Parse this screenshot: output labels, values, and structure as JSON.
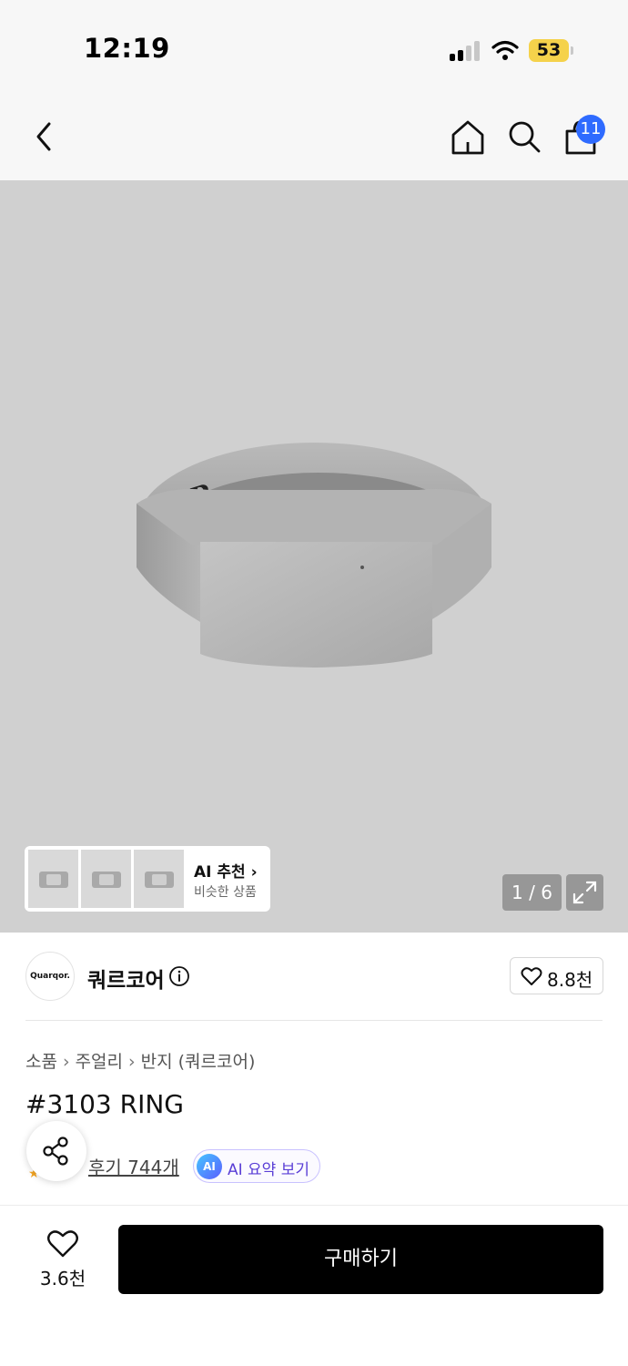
{
  "status_bar": {
    "time": "12:19",
    "battery": "53",
    "battery_color": "#f5d24b"
  },
  "nav": {
    "icons": [
      "chevron-left-icon",
      "home-icon",
      "search-icon",
      "shopping-bag-icon"
    ],
    "cart_count": "11",
    "badge_color": "#2f6bff"
  },
  "gallery": {
    "ai_recommend_title": "AI 추천 ›",
    "ai_recommend_sub": "비슷한 상품",
    "page_indicator": "1 / 6"
  },
  "brand": {
    "logo_text": "Quarqor.",
    "name": "쿼르코어",
    "likes": "8.8천"
  },
  "product": {
    "breadcrumb": [
      "소품",
      "주얼리",
      "반지 (쿼르코어)"
    ],
    "title": "#3103 RING",
    "reviews_label": "후기 744개",
    "ai_badge": "AI",
    "ai_summary_label": "AI 요약 보기",
    "ai_summary_color": "#5a3fd6"
  },
  "bottom_bar": {
    "likes": "3.6천",
    "buy_label": "구매하기"
  }
}
